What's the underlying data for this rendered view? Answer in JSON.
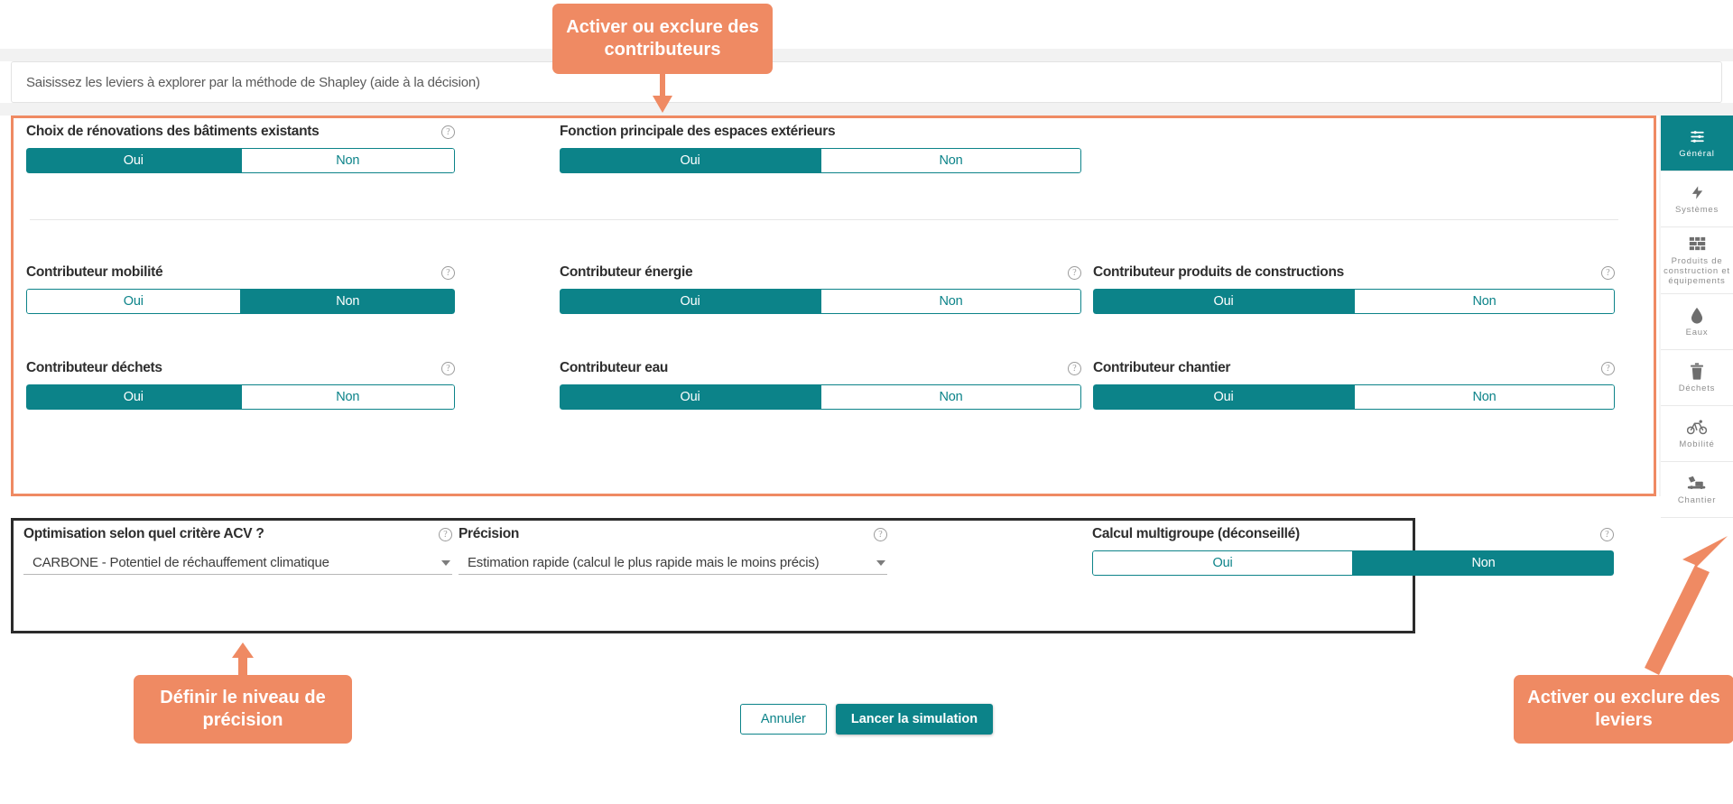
{
  "hint": {
    "text": "Saisissez les leviers à explorer par la méthode de Shapley (aide à la décision)"
  },
  "toggle_options": {
    "yes": "Oui",
    "no": "Non"
  },
  "contributors_panel": {
    "rows": [
      [
        {
          "label": "Choix de rénovations des bâtiments existants",
          "yes": "Oui",
          "no": "Non",
          "selected": "Oui",
          "has_help": true
        },
        {
          "label": "Fonction principale des espaces extérieurs",
          "yes": "Oui",
          "no": "Non",
          "selected": "Oui",
          "has_help": false
        }
      ],
      [
        {
          "label": "Contributeur mobilité",
          "yes": "Oui",
          "no": "Non",
          "selected": "Non",
          "has_help": true
        },
        {
          "label": "Contributeur énergie",
          "yes": "Oui",
          "no": "Non",
          "selected": "Oui",
          "has_help": true
        },
        {
          "label": "Contributeur produits de constructions",
          "yes": "Oui",
          "no": "Non",
          "selected": "Oui",
          "has_help": true
        }
      ],
      [
        {
          "label": "Contributeur déchets",
          "yes": "Oui",
          "no": "Non",
          "selected": "Oui",
          "has_help": true
        },
        {
          "label": "Contributeur eau",
          "yes": "Oui",
          "no": "Non",
          "selected": "Oui",
          "has_help": true
        },
        {
          "label": "Contributeur chantier",
          "yes": "Oui",
          "no": "Non",
          "selected": "Oui",
          "has_help": true
        }
      ]
    ]
  },
  "levers_panel": {
    "criteria": {
      "label": "Optimisation selon quel critère ACV ?",
      "value": "CARBONE - Potentiel de réchauffement climatique"
    },
    "precision": {
      "label": "Précision",
      "value": "Estimation rapide (calcul le plus rapide mais le moins précis)"
    },
    "multigroup": {
      "label": "Calcul multigroupe (déconseillé)",
      "yes": "Oui",
      "no": "Non",
      "selected": "Non"
    }
  },
  "sidebar": {
    "items": [
      {
        "label": "Général",
        "icon": "sliders-icon",
        "active": true
      },
      {
        "label": "Systèmes",
        "icon": "bolt-icon",
        "active": false
      },
      {
        "label": "Produits de construction et équipements",
        "icon": "brick-wall-icon",
        "active": false
      },
      {
        "label": "Eaux",
        "icon": "water-drop-icon",
        "active": false
      },
      {
        "label": "Déchets",
        "icon": "trash-icon",
        "active": false
      },
      {
        "label": "Mobilité",
        "icon": "bicycle-icon",
        "active": false
      },
      {
        "label": "Chantier",
        "icon": "excavator-icon",
        "active": false
      }
    ]
  },
  "footer": {
    "cancel_label": "Annuler",
    "run_label": "Lancer la simulation"
  },
  "callouts": {
    "top": "Activer ou exclure des contributeurs",
    "bottom_left": "Définir le niveau de précision",
    "bottom_right": "Activer ou exclure des leviers"
  },
  "colors": {
    "teal": "#0c8389",
    "orange": "#ef8a63",
    "panel_border_dark": "#2b2b2b",
    "page_bg": "#f2f2f2"
  }
}
